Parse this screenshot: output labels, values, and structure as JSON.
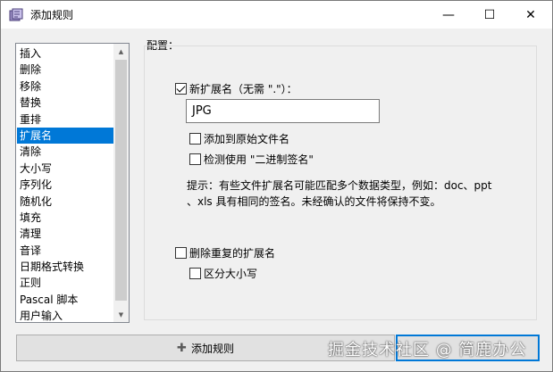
{
  "window": {
    "title": "添加规则",
    "controls": {
      "minimize": "—",
      "maximize": "☐",
      "close": "✕"
    }
  },
  "rules_list": {
    "items": [
      "插入",
      "删除",
      "移除",
      "替换",
      "重排",
      "扩展名",
      "清除",
      "大小写",
      "序列化",
      "随机化",
      "填充",
      "清理",
      "音译",
      "日期格式转换",
      "正则",
      "Pascal 脚本",
      "用户输入"
    ],
    "selected_index": 5
  },
  "config": {
    "group_label": "配置：",
    "new_extension": {
      "label": "新扩展名（无需 \".\"）：",
      "checked": true,
      "value": "JPG"
    },
    "append_to_original": {
      "label": "添加到原始文件名",
      "checked": false
    },
    "detect_binary": {
      "label": "检测使用 \"二进制签名\"",
      "checked": false
    },
    "hint_line1": "提示：有些文件扩展名可能匹配多个数据类型，例如：doc、ppt",
    "hint_line2": "、xls 具有相同的签名。未经确认的文件将保持不变。",
    "remove_duplicate": {
      "label": "删除重复的扩展名",
      "checked": false
    },
    "case_sensitive": {
      "label": "区分大小写",
      "checked": false
    }
  },
  "buttons": {
    "add_rule": "添加规则"
  },
  "watermark": "掘金技术社区 @ 简鹿办公"
}
